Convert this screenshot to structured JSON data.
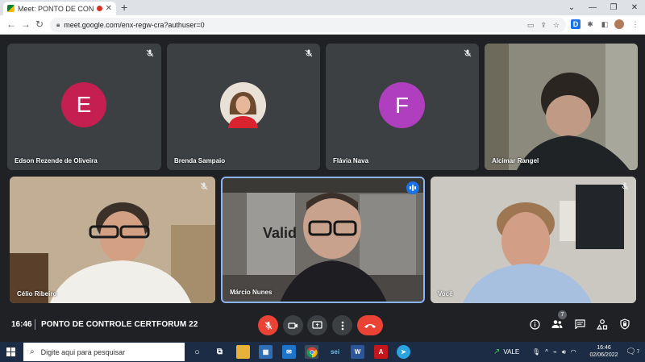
{
  "browser": {
    "tab_title": "Meet: PONTO DE CONTROLE",
    "tab_close": "✕",
    "new_tab": "+",
    "url": "meet.google.com/enx-regw-cra?authuser=0",
    "window_controls": [
      "⌄",
      "—",
      "❐",
      "✕"
    ]
  },
  "participants": [
    {
      "name": "Edson Rezende de Oliveira",
      "initial": "E",
      "avatar_color": "#c51f51",
      "muted": true
    },
    {
      "name": "Brenda Sampaio",
      "muted": true
    },
    {
      "name": "Flávia Nava",
      "initial": "F",
      "avatar_color": "#b03fbf",
      "muted": true
    },
    {
      "name": "Alcimar Rangel",
      "muted": false
    },
    {
      "name": "Célio Ribeiro",
      "muted": true
    },
    {
      "name": "Márcio Nunes",
      "muted": false,
      "speaking": true,
      "backdrop_text": "Valid"
    },
    {
      "name": "Você",
      "muted": true
    }
  ],
  "meeting": {
    "time": "16:46",
    "title": "PONTO DE CONTROLE CERTFORUM 22",
    "people_count": "7"
  },
  "taskbar": {
    "search_placeholder": "Digite aqui para pesquisar",
    "weather": "VALE",
    "time": "16:46",
    "date": "02/06/2022",
    "notifications": "7"
  },
  "colors": {
    "meet_bg": "#202124",
    "tile_bg": "#3c4043",
    "end_call": "#ea4335",
    "active_border": "#8ab4f8",
    "taskbar": "#1c2c44"
  }
}
